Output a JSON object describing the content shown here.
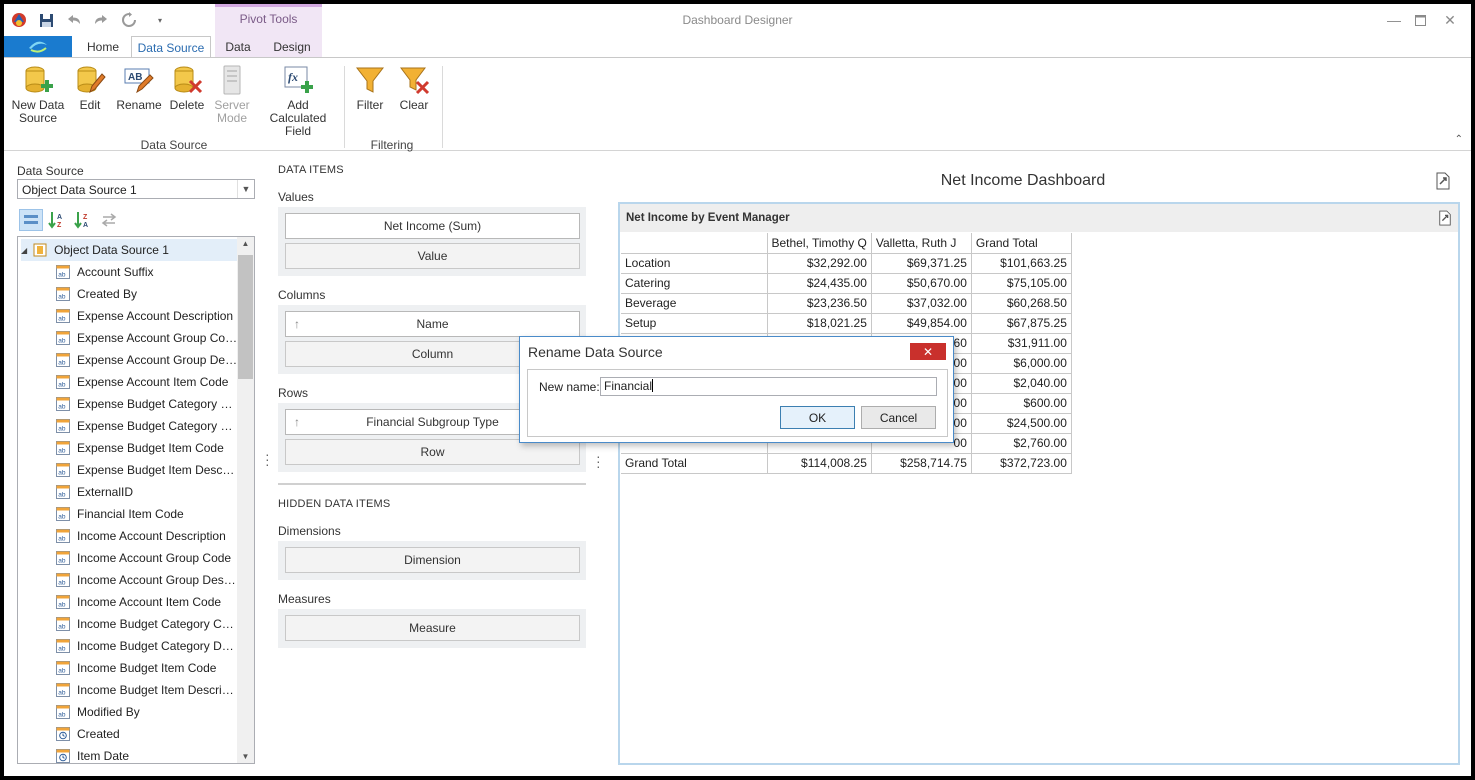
{
  "window": {
    "title": "Dashboard Designer",
    "context_tab_group": "Pivot Tools",
    "controls": [
      "minimize-icon",
      "maximize-icon",
      "close-icon"
    ]
  },
  "quick_access": [
    "app-logo-icon",
    "save-icon",
    "undo-icon",
    "redo-icon",
    "refresh-icon",
    "customize-dropdown-icon"
  ],
  "tabs": [
    {
      "label": "Home",
      "active": false
    },
    {
      "label": "Data Source",
      "active": true
    },
    {
      "label": "Data",
      "active": false
    },
    {
      "label": "Design",
      "active": false
    }
  ],
  "ribbon": {
    "groups": [
      {
        "label": "Data Source",
        "buttons": [
          {
            "label1": "New Data",
            "label2": "Source",
            "icon": "new-data-source-icon",
            "enabled": true
          },
          {
            "label1": "Edit",
            "label2": "",
            "icon": "edit-icon",
            "enabled": true
          },
          {
            "label1": "Rename",
            "label2": "",
            "icon": "rename-icon",
            "enabled": true
          },
          {
            "label1": "Delete",
            "label2": "",
            "icon": "delete-icon",
            "enabled": true
          },
          {
            "label1": "Server",
            "label2": "Mode",
            "icon": "server-mode-icon",
            "enabled": false
          },
          {
            "label1": "Add Calculated",
            "label2": "Field",
            "icon": "add-calculated-field-icon",
            "enabled": true
          }
        ]
      },
      {
        "label": "Filtering",
        "buttons": [
          {
            "label1": "Filter",
            "label2": "",
            "icon": "filter-icon",
            "enabled": true
          },
          {
            "label1": "Clear",
            "label2": "",
            "icon": "clear-filter-icon",
            "enabled": true
          }
        ]
      }
    ]
  },
  "left_panel": {
    "label": "Data Source",
    "selected_source": "Object Data Source 1",
    "toolbar": [
      "group-view-icon",
      "sort-az-icon",
      "sort-za-icon",
      "refresh-fields-icon"
    ],
    "tree_root": "Object Data Source 1",
    "fields": [
      {
        "name": "Account Suffix",
        "type": "text"
      },
      {
        "name": "Created By",
        "type": "text"
      },
      {
        "name": "Expense Account Description",
        "type": "text"
      },
      {
        "name": "Expense Account Group Code",
        "type": "text"
      },
      {
        "name": "Expense Account Group Descr…",
        "type": "text"
      },
      {
        "name": "Expense Account Item Code",
        "type": "text"
      },
      {
        "name": "Expense Budget Category Code",
        "type": "text"
      },
      {
        "name": "Expense Budget Category De…",
        "type": "text"
      },
      {
        "name": "Expense Budget Item Code",
        "type": "text"
      },
      {
        "name": "Expense Budget Item Descript…",
        "type": "text"
      },
      {
        "name": "ExternalID",
        "type": "text"
      },
      {
        "name": "Financial Item Code",
        "type": "text"
      },
      {
        "name": "Income Account Description",
        "type": "text"
      },
      {
        "name": "Income Account Group Code",
        "type": "text"
      },
      {
        "name": "Income Account Group Descri…",
        "type": "text"
      },
      {
        "name": "Income Account Item Code",
        "type": "text"
      },
      {
        "name": "Income Budget Category Code",
        "type": "text"
      },
      {
        "name": "Income Budget Category Desc…",
        "type": "text"
      },
      {
        "name": "Income Budget Item Code",
        "type": "text"
      },
      {
        "name": "Income Budget Item Description",
        "type": "text"
      },
      {
        "name": "Modified By",
        "type": "text"
      },
      {
        "name": "Created",
        "type": "date"
      },
      {
        "name": "Item Date",
        "type": "date"
      }
    ]
  },
  "data_items": {
    "title": "DATA ITEMS",
    "values_label": "Values",
    "values": [
      "Net Income (Sum)"
    ],
    "values_placeholder": "Value",
    "columns_label": "Columns",
    "columns": [
      "Name"
    ],
    "columns_placeholder": "Column",
    "rows_label": "Rows",
    "rows": [
      "Financial Subgroup Type"
    ],
    "rows_placeholder": "Row",
    "hidden_title": "HIDDEN DATA ITEMS",
    "dimensions_label": "Dimensions",
    "dimensions_placeholder": "Dimension",
    "measures_label": "Measures",
    "measures_placeholder": "Measure"
  },
  "dashboard": {
    "title": "Net Income Dashboard",
    "pivot": {
      "title": "Net Income by Event Manager",
      "columns": [
        "Bethel, Timothy Q",
        "Valletta, Ruth J",
        "Grand Total"
      ],
      "rows": [
        {
          "label": "Location",
          "values": [
            "$32,292.00",
            "$69,371.25",
            "$101,663.25"
          ]
        },
        {
          "label": "Catering",
          "values": [
            "$24,435.00",
            "$50,670.00",
            "$75,105.00"
          ]
        },
        {
          "label": "Beverage",
          "values": [
            "$23,236.50",
            "$37,032.00",
            "$60,268.50"
          ]
        },
        {
          "label": "Setup",
          "values": [
            "$18,021.25",
            "$49,854.00",
            "$67,875.25"
          ]
        },
        {
          "label": "",
          "values": [
            "",
            "60",
            "$31,911.00"
          ]
        },
        {
          "label": "",
          "values": [
            "",
            "00",
            "$6,000.00"
          ]
        },
        {
          "label": "",
          "values": [
            "",
            "00",
            "$2,040.00"
          ]
        },
        {
          "label": "",
          "values": [
            "",
            "00",
            "$600.00"
          ]
        },
        {
          "label": "",
          "values": [
            "",
            "00",
            "$24,500.00"
          ]
        },
        {
          "label": "",
          "values": [
            "",
            "00",
            "$2,760.00"
          ]
        }
      ],
      "grand_total": {
        "label": "Grand Total",
        "values": [
          "$114,008.25",
          "$258,714.75",
          "$372,723.00"
        ]
      }
    }
  },
  "dialog": {
    "title": "Rename Data Source",
    "field_label": "New name:",
    "field_value": "Financial",
    "ok_label": "OK",
    "cancel_label": "Cancel"
  },
  "colors": {
    "accent": "#1a7bcf",
    "context_tab": "#f1e6f5",
    "dialog_close": "#c9302c",
    "panel_border": "#b9d6ec"
  }
}
